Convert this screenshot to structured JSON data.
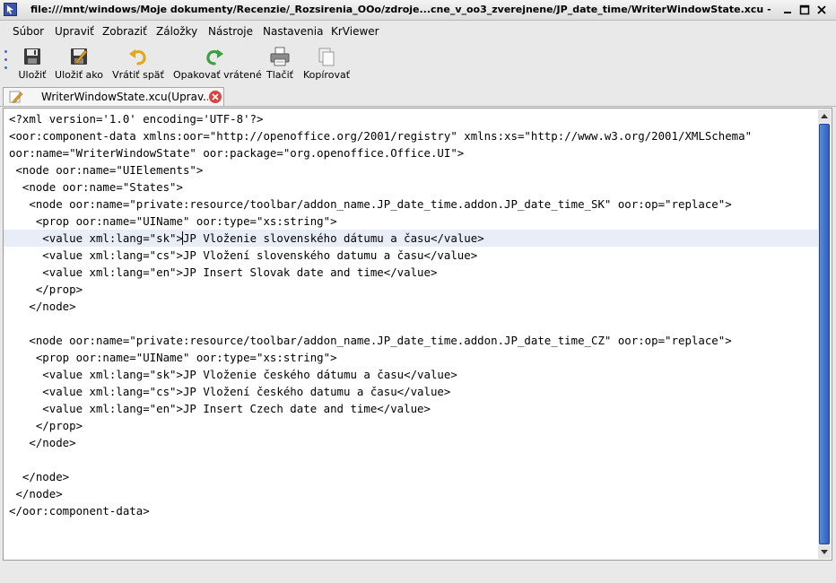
{
  "window": {
    "title": "file:///mnt/windows/Moje dokumenty/Recenzie/_Rozsirenia_OOo/zdroje...cne_v_oo3_zverejnene/JP_date_time/WriterWindowState.xcu - Krusader"
  },
  "menu": [
    {
      "label": "Súbor"
    },
    {
      "label": "Upraviť"
    },
    {
      "label": "Zobraziť"
    },
    {
      "label": "Záložky"
    },
    {
      "label": "Nástroje"
    },
    {
      "label": "Nastavenia"
    },
    {
      "label": "KrViewer"
    }
  ],
  "toolbar": {
    "save_label": "Uložiť",
    "save_as_label": "Uložiť ako",
    "undo_label": "Vrátiť späť",
    "redo_label": "Opakovať vrátené",
    "print_label": "Tlačiť",
    "copy_label": "Kopírovať"
  },
  "tab": {
    "label": "WriterWindowState.xcu(Uprav..."
  },
  "editor": {
    "lines": [
      "<?xml version='1.0' encoding='UTF-8'?>",
      "<oor:component-data xmlns:oor=\"http://openoffice.org/2001/registry\" xmlns:xs=\"http://www.w3.org/2001/XMLSchema\"",
      "oor:name=\"WriterWindowState\" oor:package=\"org.openoffice.Office.UI\">",
      " <node oor:name=\"UIElements\">",
      "  <node oor:name=\"States\">",
      "   <node oor:name=\"private:resource/toolbar/addon_name.JP_date_time.addon.JP_date_time_SK\" oor:op=\"replace\">",
      "    <prop oor:name=\"UIName\" oor:type=\"xs:string\">",
      "     <value xml:lang=\"sk\">JP Vloženie slovenského dátumu a času</value>",
      "     <value xml:lang=\"cs\">JP Vložení slovenského datumu a času</value>",
      "     <value xml:lang=\"en\">JP Insert Slovak date and time</value>",
      "    </prop>",
      "   </node>",
      "",
      "   <node oor:name=\"private:resource/toolbar/addon_name.JP_date_time.addon.JP_date_time_CZ\" oor:op=\"replace\">",
      "    <prop oor:name=\"UIName\" oor:type=\"xs:string\">",
      "     <value xml:lang=\"sk\">JP Vloženie českého dátumu a času</value>",
      "     <value xml:lang=\"cs\">JP Vložení českého datumu a času</value>",
      "     <value xml:lang=\"en\">JP Insert Czech date and time</value>",
      "    </prop>",
      "   </node>",
      "",
      "  </node>",
      " </node>",
      "</oor:component-data>"
    ],
    "current_line_index": 7
  },
  "icons": {
    "app": "krusader-app-icon",
    "minimize": "minimize-icon",
    "maximize": "maximize-icon",
    "close": "close-icon"
  }
}
